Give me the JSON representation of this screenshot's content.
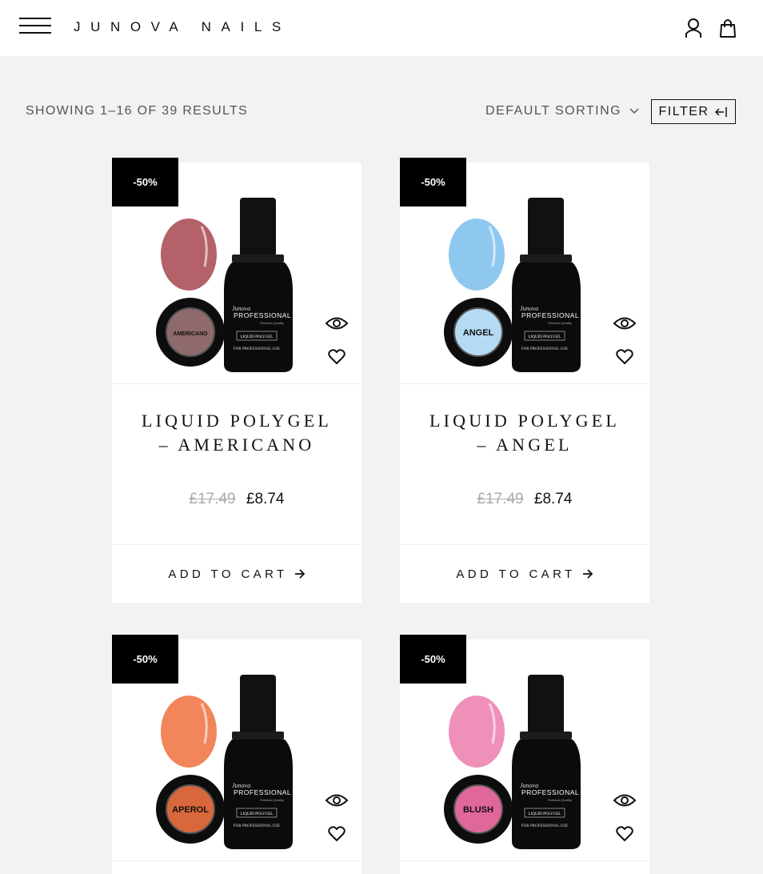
{
  "header": {
    "brand": "JUNOVA NAILS"
  },
  "toolbar": {
    "results": "SHOWING 1–16 OF 39 RESULTS",
    "sorting": "DEFAULT SORTING",
    "filter": "FILTER"
  },
  "products": [
    {
      "badge": "-50%",
      "title_line1": "LIQUID POLYGEL",
      "title_line2": "– AMERICANO",
      "old_price": "£17.49",
      "new_price": "£8.74",
      "cart_label": "ADD TO CART",
      "swatch_label": "AMERICANO",
      "nail_color": "#b4616a",
      "swatch_color": "#8e6a6c"
    },
    {
      "badge": "-50%",
      "title_line1": "LIQUID POLYGEL",
      "title_line2": "– ANGEL",
      "old_price": "£17.49",
      "new_price": "£8.74",
      "cart_label": "ADD TO CART",
      "swatch_label": "ANGEL",
      "nail_color": "#8fc8ef",
      "swatch_color": "#b5daf4"
    },
    {
      "badge": "-50%",
      "swatch_label": "APEROL",
      "nail_color": "#f3855a",
      "swatch_color": "#d8683b"
    },
    {
      "badge": "-50%",
      "swatch_label": "BLUSH",
      "nail_color": "#ee90b8",
      "swatch_color": "#e0679a"
    }
  ],
  "bottle": {
    "brand_script": "Junova",
    "brand_word": "PROFESSIONAL",
    "brand_sub": "Premium Quality",
    "product": "LIQUID POLYGEL",
    "usage": "FOR PROFESSIONAL USE"
  },
  "colors": {
    "badge_bg": "#000000",
    "page_bg": "#f2f2f2",
    "old_price": "#aaaaaa"
  }
}
